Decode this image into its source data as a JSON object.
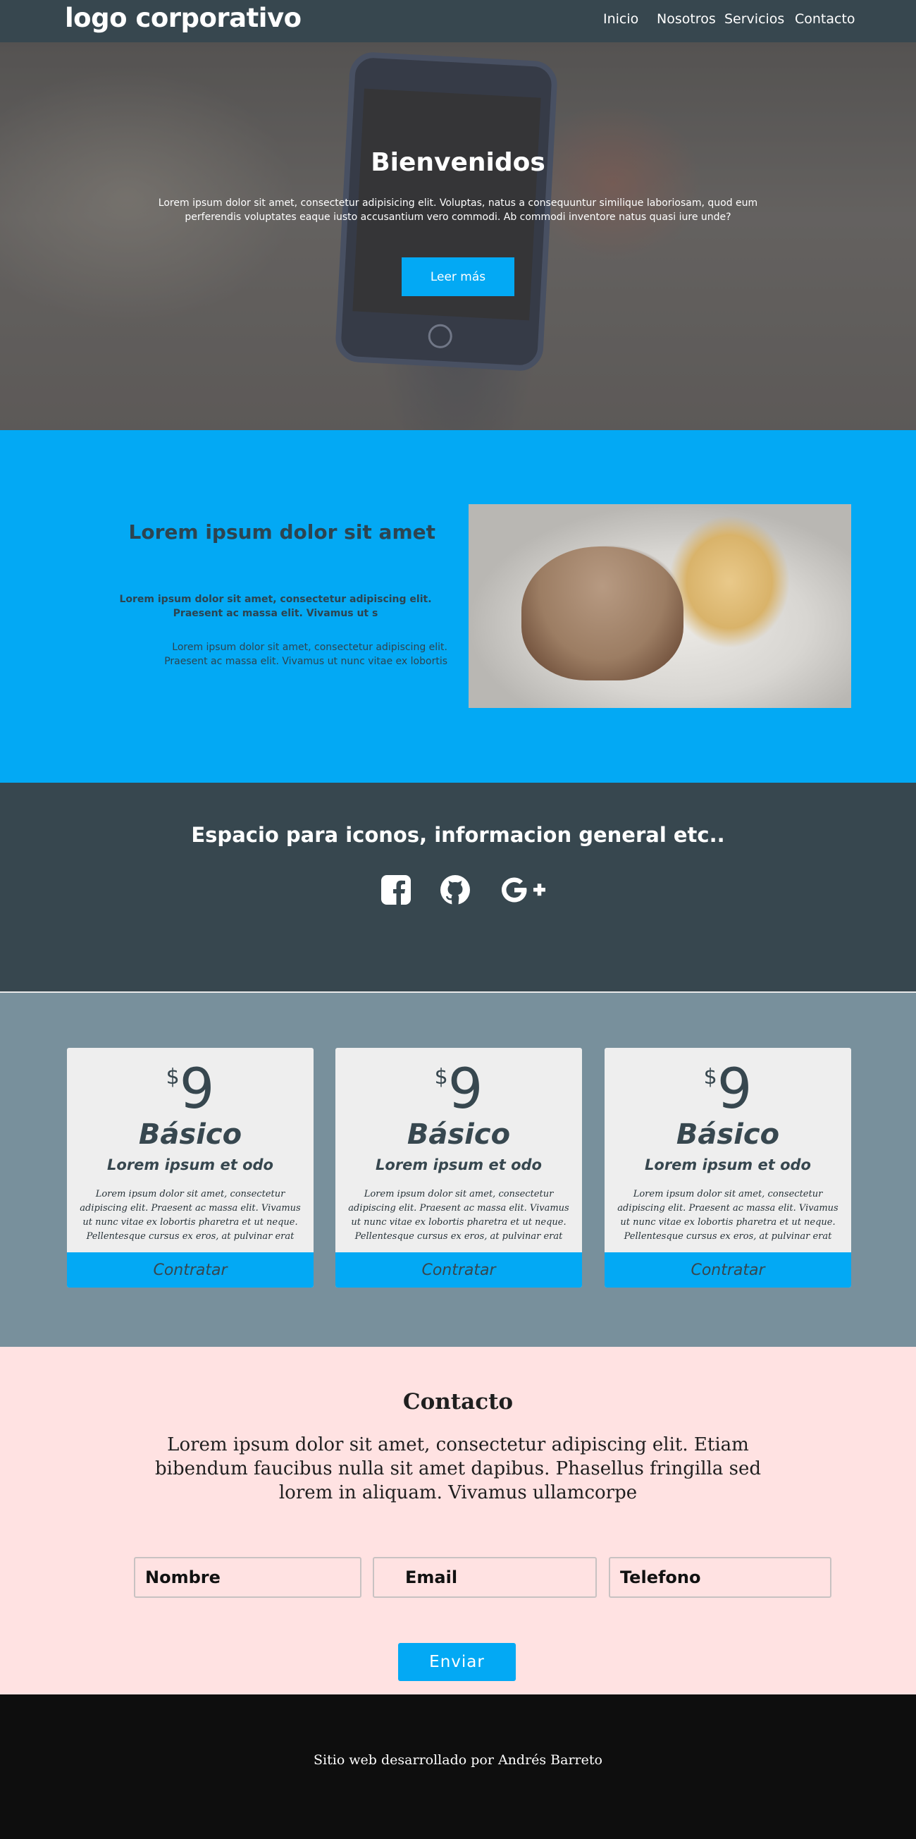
{
  "navbar": {
    "logo": "logo corporativo",
    "links": [
      "Inicio",
      "Nosotros",
      "Servicios",
      "Contacto"
    ]
  },
  "hero": {
    "title": "Bienvenidos",
    "text": "Lorem ipsum dolor sit amet, consectetur adipisicing elit. Voluptas, natus a consequuntur similique laboriosam, quod eum perferendis voluptates eaque iusto accusantium vero commodi. Ab commodi inventore natus quasi iure unde?",
    "button": "Leer más"
  },
  "about": {
    "title": "Lorem ipsum dolor sit amet",
    "bold_text": "Lorem ipsum dolor sit amet, consectetur adipiscing elit. Praesent ac massa elit. Vivamus ut s",
    "text": "Lorem ipsum dolor sit amet, consectetur adipiscing elit. Praesent ac massa elit. Vivamus ut nunc vitae ex lobortis"
  },
  "icons_section": {
    "title": "Espacio para iconos, informacion general etc..",
    "icons": [
      "facebook-icon",
      "github-icon",
      "google-plus-icon"
    ]
  },
  "pricing": {
    "cards": [
      {
        "currency": "$",
        "amount": "9",
        "plan": "Básico",
        "subtitle": "Lorem ipsum et odo",
        "description": "Lorem ipsum dolor sit amet, consectetur adipiscing elit. Praesent ac massa elit. Vivamus ut nunc vitae ex lobortis pharetra et ut neque. Pellentesque cursus ex eros, at pulvinar erat",
        "button": "Contratar"
      },
      {
        "currency": "$",
        "amount": "9",
        "plan": "Básico",
        "subtitle": "Lorem ipsum et odo",
        "description": "Lorem ipsum dolor sit amet, consectetur adipiscing elit. Praesent ac massa elit. Vivamus ut nunc vitae ex lobortis pharetra et ut neque. Pellentesque cursus ex eros, at pulvinar erat",
        "button": "Contratar"
      },
      {
        "currency": "$",
        "amount": "9",
        "plan": "Básico",
        "subtitle": "Lorem ipsum et odo",
        "description": "Lorem ipsum dolor sit amet, consectetur adipiscing elit. Praesent ac massa elit. Vivamus ut nunc vitae ex lobortis pharetra et ut neque. Pellentesque cursus ex eros, at pulvinar erat",
        "button": "Contratar"
      }
    ]
  },
  "contact": {
    "title": "Contacto",
    "text": "Lorem ipsum dolor sit amet, consectetur adipiscing elit. Etiam bibendum faucibus nulla sit amet dapibus. Phasellus fringilla sed lorem in aliquam. Vivamus ullamcorpe",
    "fields": {
      "name": "Nombre",
      "email": "Email",
      "phone": "Telefono"
    },
    "button": "Enviar"
  },
  "footer": {
    "text": "Sitio web desarrollado por Andrés Barreto"
  },
  "colors": {
    "navbar": "#37474f",
    "accent": "#03a9f4",
    "pricing_bg": "#78909c",
    "contact_bg": "#ffe2e2",
    "footer_bg": "#0e0e0e"
  }
}
